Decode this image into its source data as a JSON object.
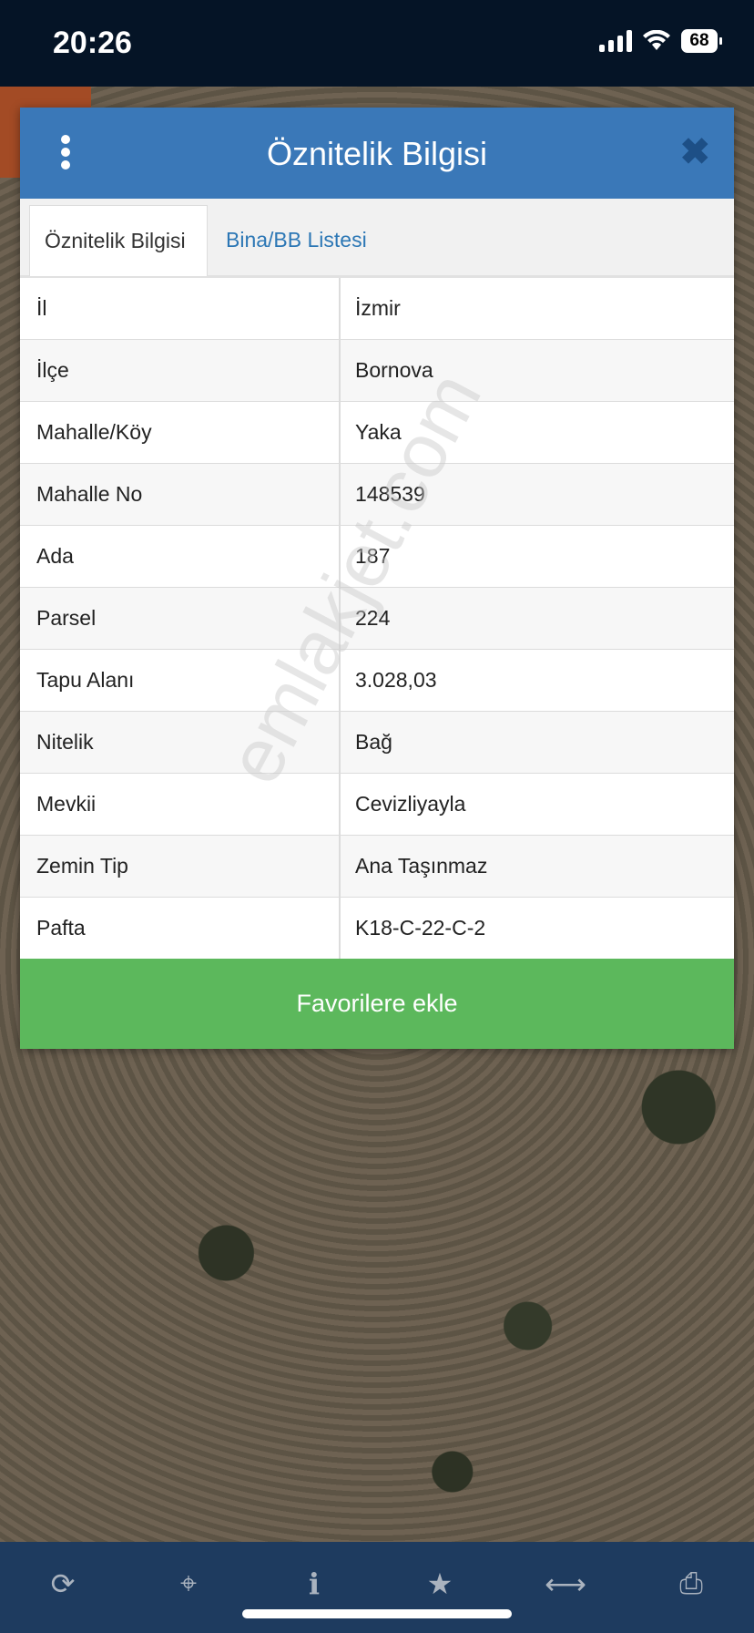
{
  "status_bar": {
    "time": "20:26",
    "battery": "68"
  },
  "panel": {
    "title": "Öznitelik Bilgisi",
    "tabs": [
      "Öznitelik Bilgisi",
      "Bina/BB Listesi"
    ],
    "rows": [
      {
        "key": "İl",
        "value": "İzmir"
      },
      {
        "key": "İlçe",
        "value": "Bornova"
      },
      {
        "key": "Mahalle/Köy",
        "value": "Yaka"
      },
      {
        "key": "Mahalle No",
        "value": "148539"
      },
      {
        "key": "Ada",
        "value": "187"
      },
      {
        "key": "Parsel",
        "value": "224"
      },
      {
        "key": "Tapu Alanı",
        "value": "3.028,03"
      },
      {
        "key": "Nitelik",
        "value": "Bağ"
      },
      {
        "key": "Mevkii",
        "value": "Cevizliyayla"
      },
      {
        "key": "Zemin Tip",
        "value": "Ana Taşınmaz"
      },
      {
        "key": "Pafta",
        "value": "K18-C-22-C-2"
      }
    ],
    "favorite_button": "Favorilere ekle"
  },
  "watermark": "emlakjet.com",
  "toolbar": {
    "icons": [
      "refresh-icon",
      "crosshair-icon",
      "info-icon",
      "star-icon",
      "measure-icon",
      "print-icon"
    ]
  },
  "colors": {
    "header": "#3a78b8",
    "button": "#5cb85c",
    "tab_link": "#2c77b5",
    "toolbar": "#1e3b5f"
  }
}
